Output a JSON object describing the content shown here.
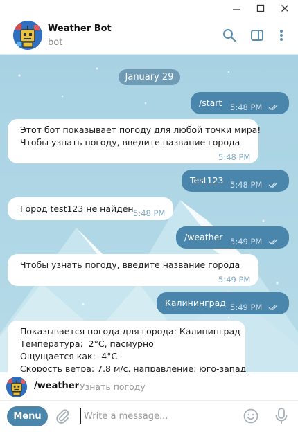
{
  "window": {
    "minimize_icon": "minimize-icon",
    "maximize_icon": "maximize-icon",
    "close_icon": "close-icon"
  },
  "header": {
    "title": "Weather Bot",
    "subtitle": "bot",
    "icons": [
      "search-icon",
      "sidebar-toggle-icon",
      "more-vertical-icon"
    ]
  },
  "chat": {
    "date": "January 29",
    "messages": [
      {
        "direction": "out",
        "text": "/start",
        "time": "5:48 PM",
        "read": true
      },
      {
        "direction": "in",
        "text": "Этот бот показывает погоду для любой точки мира!\nЧтобы узнать погоду, введите название города",
        "time": "5:48 PM"
      },
      {
        "direction": "out",
        "text": "Test123",
        "time": "5:48 PM",
        "read": true
      },
      {
        "direction": "in",
        "text": "Город test123 не найден",
        "time": "5:48 PM"
      },
      {
        "direction": "out",
        "text": "/weather",
        "time": "5:49 PM",
        "read": true
      },
      {
        "direction": "in",
        "text": "Чтобы узнать погоду, введите название города",
        "time": "5:49 PM"
      },
      {
        "direction": "out",
        "text": "Калининград",
        "time": "5:49 PM",
        "read": true
      },
      {
        "direction": "in",
        "text": "Показывается погода для города: Калининград\nТемпература:  2°C, пасмурно\nОщущается как: -4°C\nСкорость ветра: 7.8 м/с, направление: юго-запад",
        "time": ""
      }
    ]
  },
  "command_suggestion": {
    "command": "/weather",
    "description": "Узнать погоду"
  },
  "composer": {
    "menu_label": "Menu",
    "placeholder": "Write a message...",
    "value": ""
  },
  "colors": {
    "accent": "#4a86ab",
    "outgoing_bubble": "#4a86ab",
    "incoming_bubble": "#ffffff",
    "chat_background": "#a9d3e4",
    "date_pill": "#6f9bb5"
  }
}
